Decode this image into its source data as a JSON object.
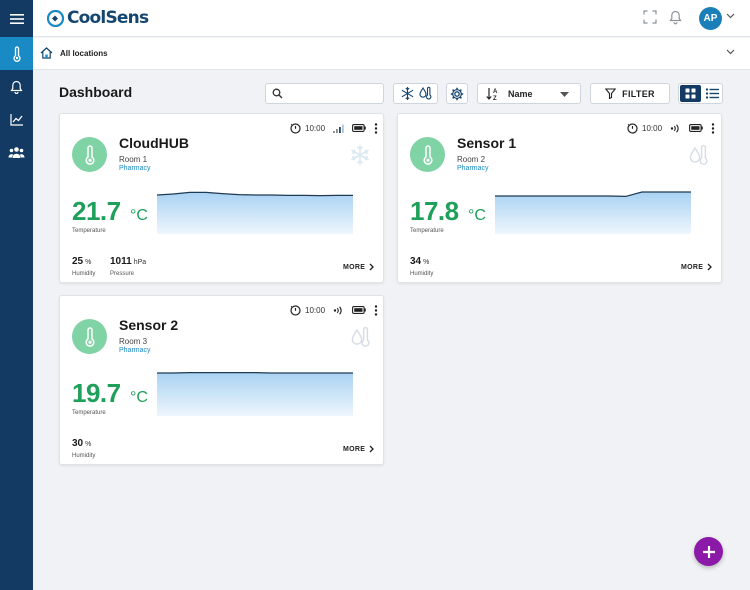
{
  "app": {
    "brand": "CoolSens",
    "avatar_initials": "AP"
  },
  "location": {
    "label": "All locations"
  },
  "page": {
    "title": "Dashboard"
  },
  "toolbar": {
    "search_placeholder": "",
    "sort_label": "Name",
    "filter_label": "FILTER"
  },
  "colors": {
    "sidebar": "#133a63",
    "sidebar_active": "#1a8ac4",
    "temp_green": "#1fa05a",
    "circle_green": "#7fd3a4",
    "fab_purple": "#8b1aa8",
    "category_blue": "#1a8ac4"
  },
  "cards": [
    {
      "name": "CloudHUB",
      "room": "Room 1",
      "category": "Pharmacy",
      "time": "10:00",
      "temperature": "21.7",
      "temp_unit": "°C",
      "temp_label": "Temperature",
      "type_icon": "snowflake-icon",
      "connectivity_icon": "signal-bars-icon",
      "metrics": [
        {
          "value": "25",
          "unit": "%",
          "label": "Humidity"
        },
        {
          "value": "1011",
          "unit": "hPa",
          "label": "Pressure"
        }
      ],
      "more_label": "MORE",
      "trend": [
        0.35,
        0.3,
        0.22,
        0.22,
        0.28,
        0.33,
        0.35,
        0.35,
        0.37,
        0.37,
        0.38,
        0.37,
        0.37
      ]
    },
    {
      "name": "Sensor 1",
      "room": "Room 2",
      "category": "Pharmacy",
      "time": "10:00",
      "temperature": "17.8",
      "temp_unit": "°C",
      "temp_label": "Temperature",
      "type_icon": "droplet-thermometer-icon",
      "connectivity_icon": "radio-waves-icon",
      "metrics": [
        {
          "value": "34",
          "unit": "%",
          "label": "Humidity"
        }
      ],
      "more_label": "MORE",
      "trend": [
        0.4,
        0.4,
        0.4,
        0.4,
        0.4,
        0.4,
        0.4,
        0.4,
        0.42,
        0.2,
        0.2,
        0.2,
        0.2
      ]
    },
    {
      "name": "Sensor 2",
      "room": "Room 3",
      "category": "Pharmacy",
      "time": "10:00",
      "temperature": "19.7",
      "temp_unit": "°C",
      "temp_label": "Temperature",
      "type_icon": "droplet-thermometer-icon",
      "connectivity_icon": "radio-waves-icon",
      "metrics": [
        {
          "value": "30",
          "unit": "%",
          "label": "Humidity"
        }
      ],
      "more_label": "MORE",
      "trend": [
        0.15,
        0.15,
        0.13,
        0.13,
        0.13,
        0.13,
        0.13,
        0.15,
        0.15,
        0.15,
        0.15,
        0.15,
        0.15
      ]
    }
  ]
}
